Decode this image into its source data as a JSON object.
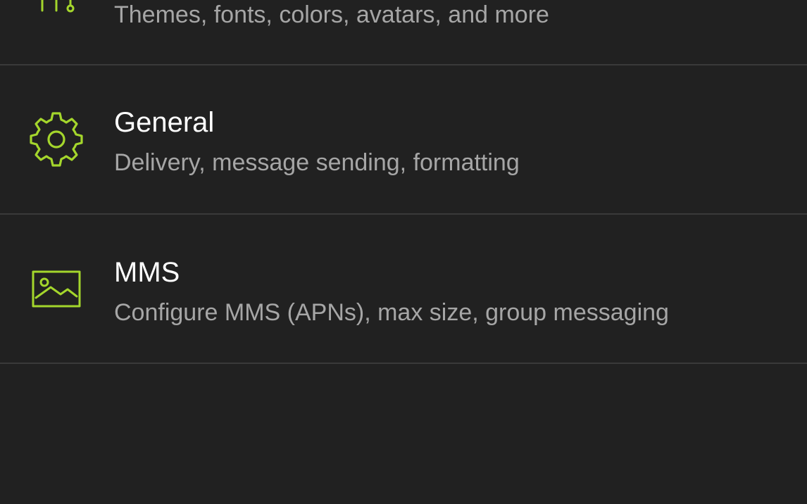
{
  "accent_color": "#a4d62c",
  "background_color": "#212121",
  "settings": [
    {
      "icon": "sliders-icon",
      "title": "",
      "subtitle": "Themes, fonts, colors, avatars, and more"
    },
    {
      "icon": "gear-icon",
      "title": "General",
      "subtitle": "Delivery, message sending, formatting"
    },
    {
      "icon": "image-icon",
      "title": "MMS",
      "subtitle": "Configure MMS (APNs), max size, group messaging"
    }
  ]
}
